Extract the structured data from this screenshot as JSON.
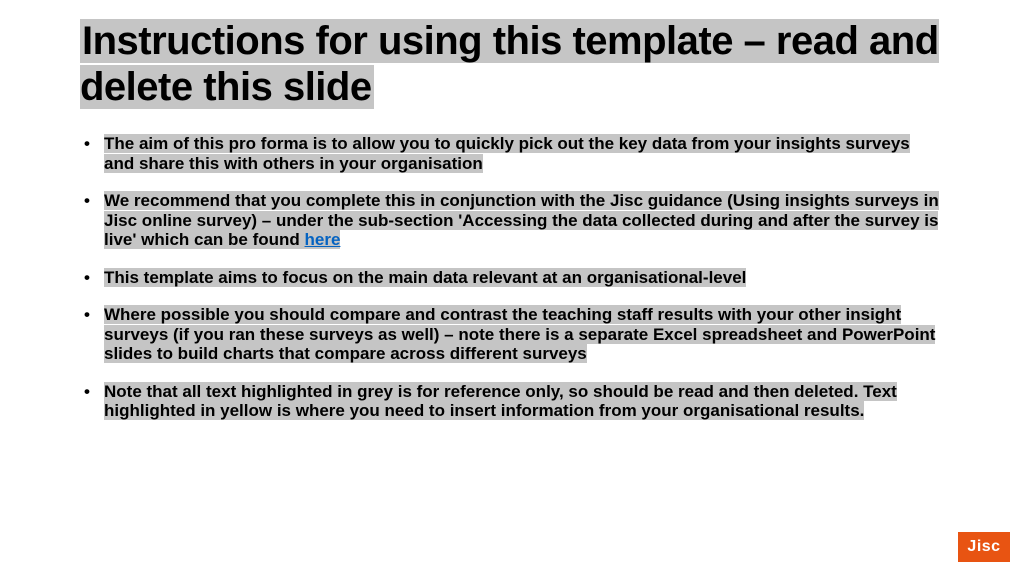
{
  "title": "Instructions for using this template – read and delete this slide",
  "bullets": [
    {
      "text": "The aim of this pro forma is to allow you to quickly pick out the key data from your insights surveys and share this with others in your organisation"
    },
    {
      "text_before_link": "We recommend that you complete this in conjunction with the Jisc guidance (Using insights surveys in Jisc online survey) – under the sub-section 'Accessing the data collected during and after the survey is live' which can be found ",
      "link_text": "here"
    },
    {
      "text": "This template aims to focus on the main data relevant at an organisational-level"
    },
    {
      "text": "Where possible you should compare and contrast the teaching staff results with your other insight surveys (if you ran these surveys as well) – note there is a separate Excel spreadsheet and PowerPoint slides to build charts that compare across different surveys"
    },
    {
      "text": "Note that all text highlighted in grey is for reference only, so should be read and then deleted. Text highlighted in yellow is where you need to insert information from your organisational results."
    }
  ],
  "logo": "Jisc",
  "colors": {
    "highlight": "#c5c5c5",
    "link": "#0563c1",
    "logo_bg": "#e85412"
  }
}
